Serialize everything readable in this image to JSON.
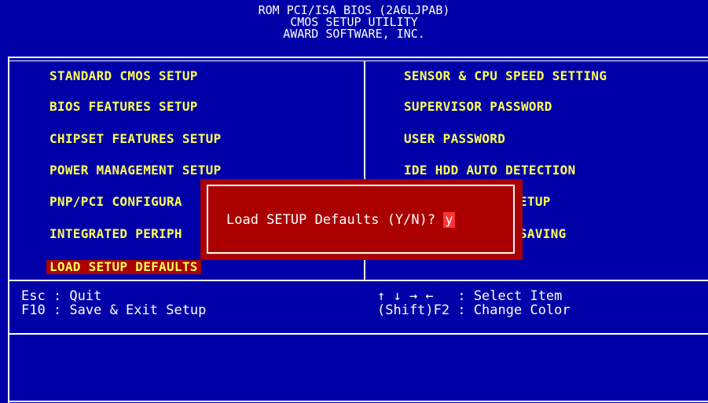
{
  "header": {
    "line1": "ROM PCI/ISA BIOS (2A6LJPAB)",
    "line2": "CMOS SETUP UTILITY",
    "line3": "AWARD SOFTWARE, INC."
  },
  "menu_left": [
    {
      "label": "STANDARD CMOS SETUP"
    },
    {
      "label": "BIOS FEATURES SETUP"
    },
    {
      "label": "CHIPSET FEATURES SETUP"
    },
    {
      "label": "POWER MANAGEMENT SETUP"
    },
    {
      "label": "PNP/PCI CONFIGURA"
    },
    {
      "label": "INTEGRATED PERIPH"
    },
    {
      "label": "LOAD SETUP DEFAULTS"
    }
  ],
  "menu_right": [
    {
      "label": "SENSOR & CPU SPEED SETTING"
    },
    {
      "label": "SUPERVISOR PASSWORD"
    },
    {
      "label": "USER PASSWORD"
    },
    {
      "label": "IDE HDD AUTO DETECTION"
    },
    {
      "label": "ETUP"
    },
    {
      "label": "SAVING"
    }
  ],
  "help": {
    "esc": "Esc : Quit",
    "f10": "F10 : Save & Exit Setup",
    "arrows": "↑ ↓ → ←   : Select Item",
    "shift_f2": "(Shift)F2 : Change Color"
  },
  "dialog": {
    "prompt": "Load SETUP Defaults (Y/N)? ",
    "value": "y"
  },
  "colors": {
    "background": "#0000a8",
    "menu_text": "#ffff55",
    "highlight": "#aa0000",
    "dialog": "#aa0000"
  }
}
